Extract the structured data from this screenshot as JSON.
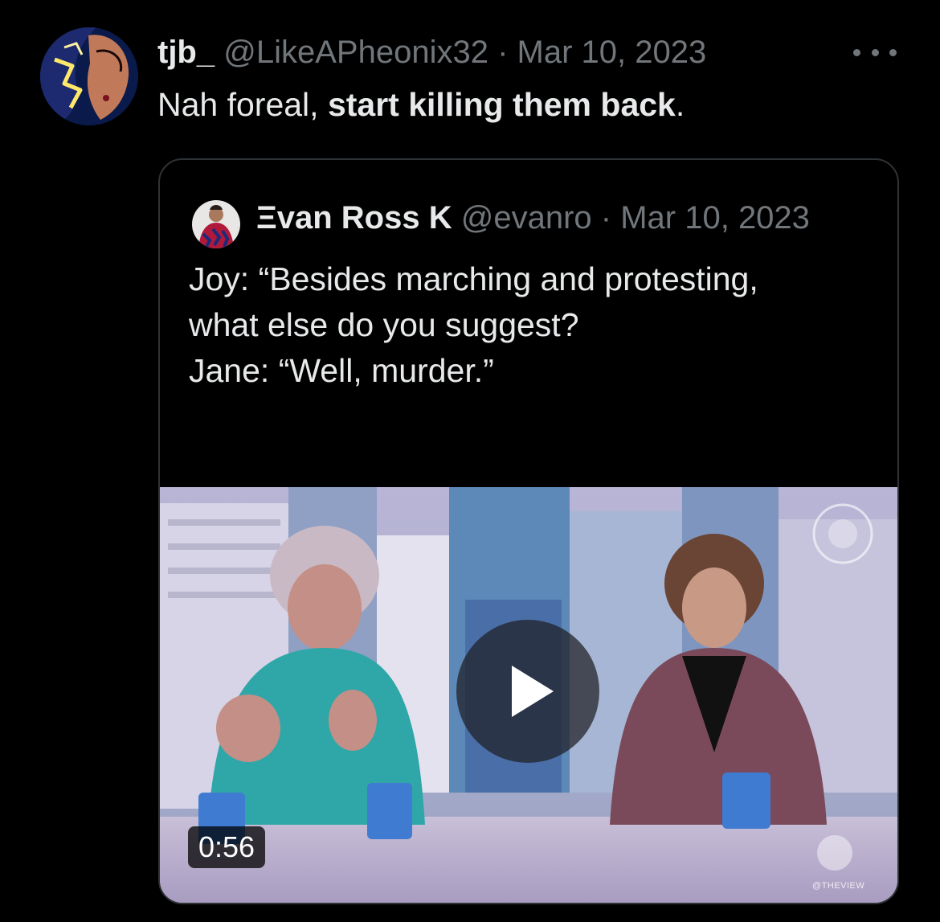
{
  "tweet": {
    "display_name": "tjb_",
    "handle": "@LikeAPheonix32",
    "separator": "·",
    "date": "Mar 10, 2023",
    "more_icon": "more-horizontal-icon",
    "text_plain": "Nah foreal, ",
    "text_bold": "start killing them back",
    "text_end": "."
  },
  "quote": {
    "display_name": "Ξvan Ross K",
    "handle": "@evanro",
    "separator": "·",
    "date": "Mar 10, 2023",
    "lines": [
      "Joy: “Besides marching and protesting,",
      "what else do you suggest?",
      "",
      "Jane: “Well, murder.”"
    ],
    "media": {
      "duration": "0:56",
      "play_icon": "play-icon",
      "watermark": "@THEVIEW"
    }
  },
  "colors": {
    "background": "#000000",
    "primary_text": "#e7e9ea",
    "secondary_text": "#71767b",
    "border": "#2f3336"
  }
}
